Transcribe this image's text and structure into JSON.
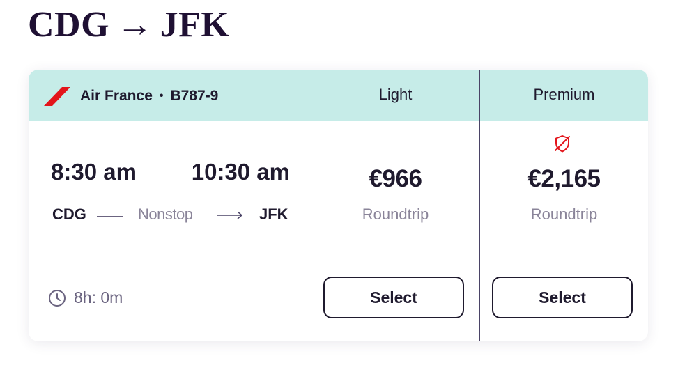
{
  "route": {
    "from": "CDG",
    "arrow": "→",
    "to": "JFK"
  },
  "flight": {
    "airline": "Air France",
    "separator": "•",
    "aircraft": "B787-9",
    "departure_time": "8:30 am",
    "arrival_time": "10:30 am",
    "origin": "CDG",
    "destination": "JFK",
    "stops_label": "Nonstop",
    "duration": "8h: 0m"
  },
  "fares": [
    {
      "name": "Light",
      "price": "€966",
      "trip_type": "Roundtrip",
      "button": "Select"
    },
    {
      "name": "Premium",
      "price": "€2,165",
      "trip_type": "Roundtrip",
      "button": "Select",
      "icon": "shield-off-icon"
    }
  ],
  "colors": {
    "header_bg": "#c6ece8",
    "brand_red": "#e3151b",
    "title": "#1f1033",
    "text": "#1f1a2e",
    "muted": "#8a8499"
  }
}
